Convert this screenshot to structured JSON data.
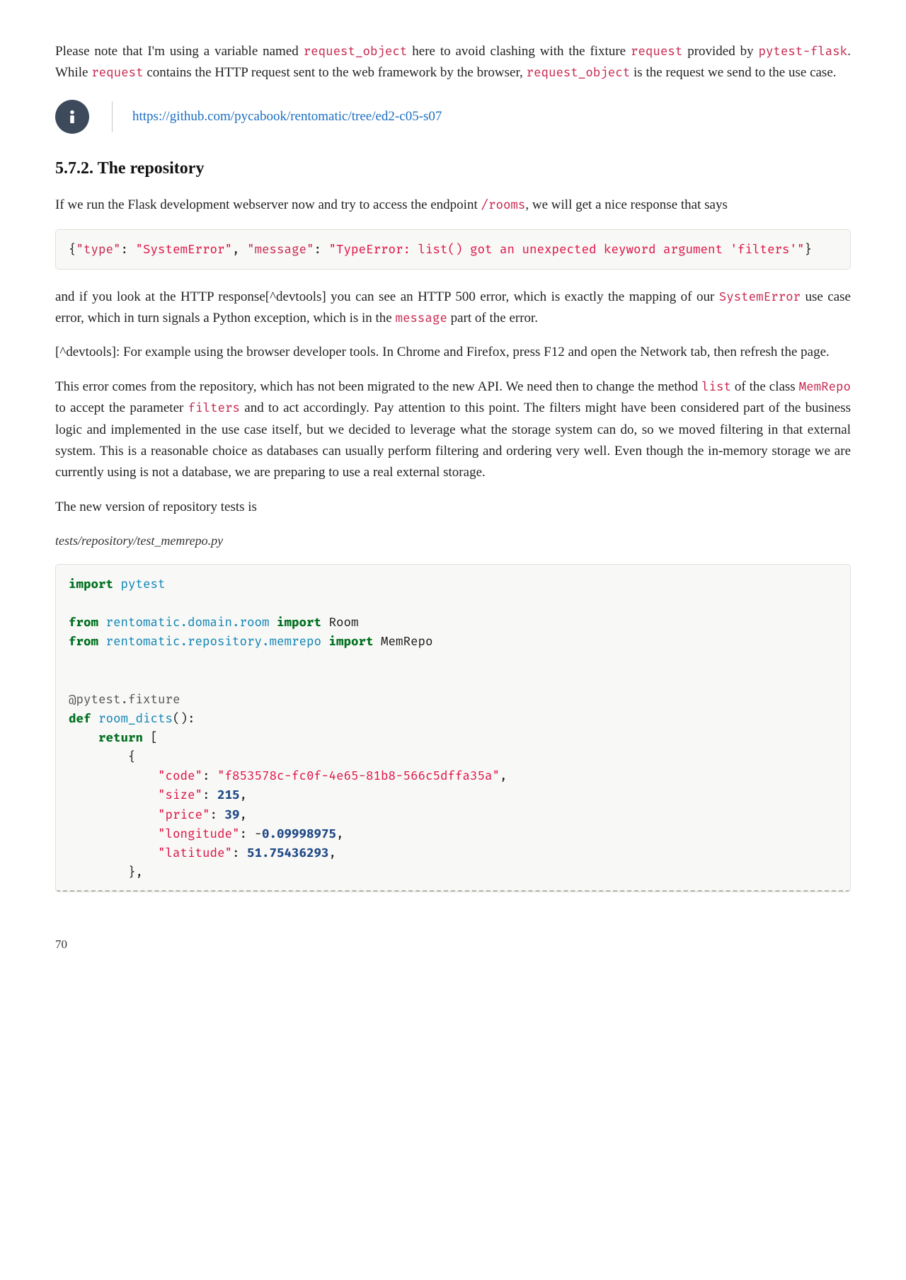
{
  "para1": {
    "t1": "Please note that I'm using a variable named ",
    "c1": "request_object",
    "t2": " here to avoid clashing with the fixture ",
    "c2": "request",
    "t3": " provided by ",
    "c3": "pytest-flask",
    "t4": ". While ",
    "c4": "request",
    "t5": " contains the HTTP request sent to the web framework by the browser, ",
    "c5": "request_object",
    "t6": " is the request we send to the use case."
  },
  "info_link": "https://github.com/pycabook/rentomatic/tree/ed2-c05-s07",
  "heading": "5.7.2. The repository",
  "para2": {
    "t1": "If we run the Flask development webserver now and try to access the endpoint ",
    "c1": "/rooms",
    "t2": ", we will get a nice response that says"
  },
  "codeblock1": {
    "p1": "{",
    "k1": "\"type\"",
    "p2": ": ",
    "v1": "\"SystemError\"",
    "p3": ", ",
    "k2": "\"message\"",
    "p4": ": ",
    "v2": "\"TypeError: list() got an unexpected keyword argument 'filters'\"",
    "p5": "}"
  },
  "para3": {
    "t1": "and if you look at the HTTP response[^devtools] you can see an HTTP 500 error, which is exactly the mapping of our ",
    "c1": "SystemError",
    "t2": " use case error, which in turn signals a Python exception, which is in the ",
    "c2": "message",
    "t3": " part of the error."
  },
  "para4": "[^devtools]: For example using the browser developer tools. In Chrome and Firefox, press F12 and open the Network tab, then refresh the page.",
  "para5": {
    "t1": "This error comes from the repository, which has not been migrated to the new API. We need then to change the method ",
    "c1": "list",
    "t2": " of the class ",
    "c2": "MemRepo",
    "t3": " to accept the parameter ",
    "c3": "filters",
    "t4": " and to act accordingly. Pay attention to this point. The filters might have been considered part of the business logic and implemented in the use case itself, but we decided to leverage what the storage system can do, so we moved filtering in that external system. This is a reasonable choice as databases can usually perform filtering and ordering very well. Even though the in-memory storage we are currently using is not a database, we are preparing to use a real external storage."
  },
  "para6": "The new version of repository tests is",
  "code_caption": "tests/repository/test_memrepo.py",
  "listing": {
    "kw_import": "import",
    "kw_from": "from",
    "kw_def": "def",
    "kw_return": "return",
    "pytest": "pytest",
    "mod1": "rentomatic.domain.room",
    "cls_room": "Room",
    "mod2": "rentomatic.repository.memrepo",
    "cls_memrepo": "MemRepo",
    "decorator": "@pytest.fixture",
    "funcname": "room_dicts",
    "funcparen": "():",
    "lbrack": "[",
    "lbrace": "{",
    "k_code": "\"code\"",
    "v_code": "\"f853578c-fc0f-4e65-81b8-566c5dffa35a\"",
    "k_size": "\"size\"",
    "v_size": "215",
    "k_price": "\"price\"",
    "v_price": "39",
    "k_lon": "\"longitude\"",
    "v_lon_neg": "-",
    "v_lon": "0.09998975",
    "k_lat": "\"latitude\"",
    "v_lat": "51.75436293",
    "rbrace_comma": "},",
    "colon_sp": ": ",
    "comma": ","
  },
  "page_number": "70"
}
